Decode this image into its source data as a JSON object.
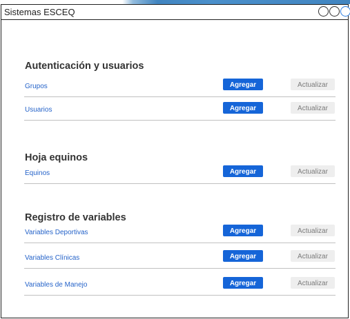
{
  "window": {
    "title": "Sistemas ESCEQ"
  },
  "sections": [
    {
      "title": "Autenticación y usuarios",
      "rows": [
        {
          "label": "Grupos",
          "add_label": "Agregar",
          "update_label": "Actualizar"
        },
        {
          "label": "Usuarios",
          "add_label": "Agregar",
          "update_label": "Actualizar"
        }
      ]
    },
    {
      "title": "Hoja equinos",
      "rows": [
        {
          "label": "Equinos",
          "add_label": "Agregar",
          "update_label": "Actualizar"
        }
      ]
    },
    {
      "title": "Registro de variables",
      "rows": [
        {
          "label": "Variables Deportivas",
          "add_label": "Agregar",
          "update_label": "Actualizar"
        },
        {
          "label": "Variables Clínicas",
          "add_label": "Agregar",
          "update_label": "Actualizar"
        },
        {
          "label": "Variables de Manejo",
          "add_label": "Agregar",
          "update_label": "Actualizar"
        }
      ]
    }
  ],
  "colors": {
    "accent": "#1565d8",
    "link": "#2563c9",
    "update_button_bg": "#eeeeee",
    "update_button_text": "#7a7a7a"
  }
}
